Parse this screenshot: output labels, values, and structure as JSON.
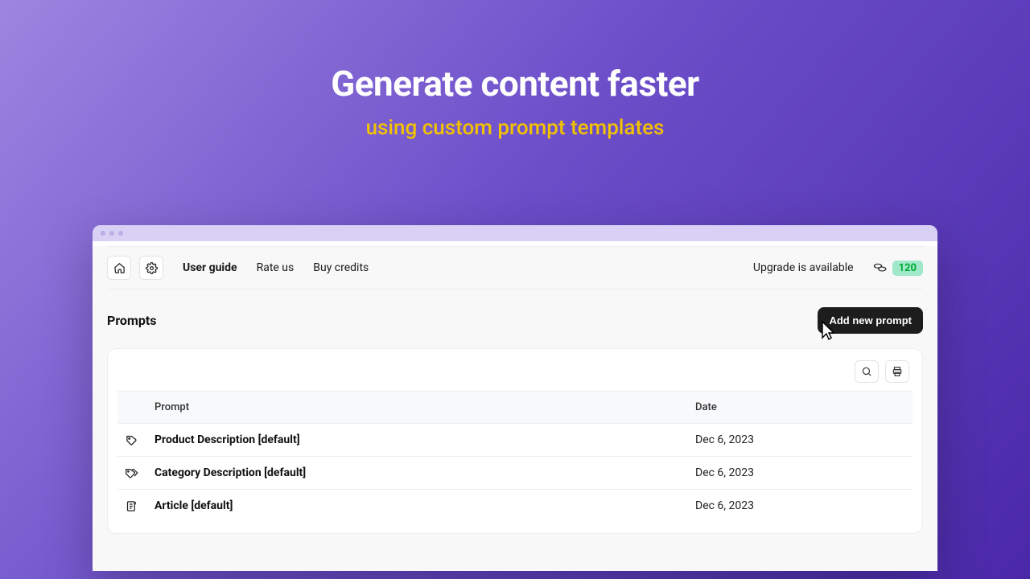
{
  "hero": {
    "title": "Generate content faster",
    "subtitle": "using custom prompt templates"
  },
  "topbar": {
    "user_guide": "User guide",
    "rate_us": "Rate us",
    "buy_credits": "Buy credits",
    "upgrade": "Upgrade is available",
    "credits": "120"
  },
  "page": {
    "title": "Prompts",
    "add_button": "Add new prompt"
  },
  "table": {
    "col_prompt": "Prompt",
    "col_date": "Date",
    "rows": [
      {
        "icon": "tag",
        "name": "Product Description [default]",
        "date": "Dec 6, 2023"
      },
      {
        "icon": "tags",
        "name": "Category Description [default]",
        "date": "Dec 6, 2023"
      },
      {
        "icon": "article",
        "name": "Article [default]",
        "date": "Dec 6, 2023"
      }
    ]
  }
}
